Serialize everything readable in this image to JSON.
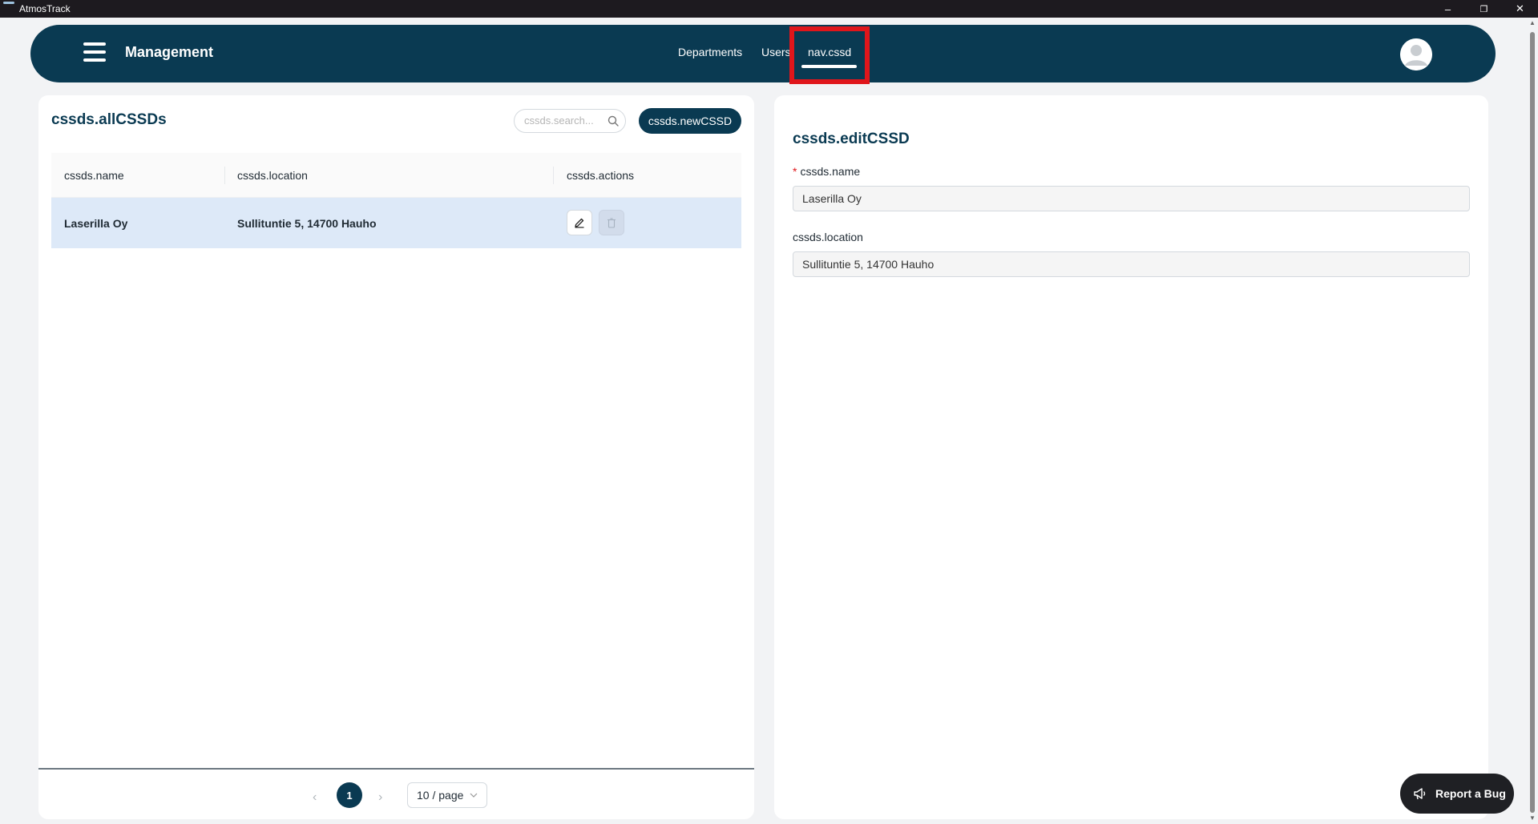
{
  "window": {
    "title": "AtmosTrack",
    "controls": {
      "minimize": "–",
      "restore": "❐",
      "close": "✕"
    }
  },
  "nav": {
    "brand": "Management",
    "links": [
      {
        "label": "Departments",
        "active": false
      },
      {
        "label": "Users",
        "active": false
      },
      {
        "label": "nav.cssd",
        "active": true
      }
    ]
  },
  "list": {
    "title": "cssds.allCSSDs",
    "search_placeholder": "cssds.search...",
    "new_button": "cssds.newCSSD",
    "columns": [
      "cssds.name",
      "cssds.location",
      "cssds.actions"
    ],
    "rows": [
      {
        "name": "Laserilla Oy",
        "location": "Sullituntie 5, 14700 Hauho",
        "selected": true
      }
    ],
    "pagination": {
      "current_page": "1",
      "page_size": "10 / page"
    }
  },
  "edit": {
    "title": "cssds.editCSSD",
    "fields": [
      {
        "label": "cssds.name",
        "required": true,
        "value": "Laserilla Oy"
      },
      {
        "label": "cssds.location",
        "required": false,
        "value": "Sullituntie 5, 14700 Hauho"
      }
    ]
  },
  "report_bug": {
    "label": "Report a Bug"
  },
  "colors": {
    "primary": "#0a3a52",
    "selected_row": "#dde9f8",
    "highlight": "#e0161b"
  }
}
